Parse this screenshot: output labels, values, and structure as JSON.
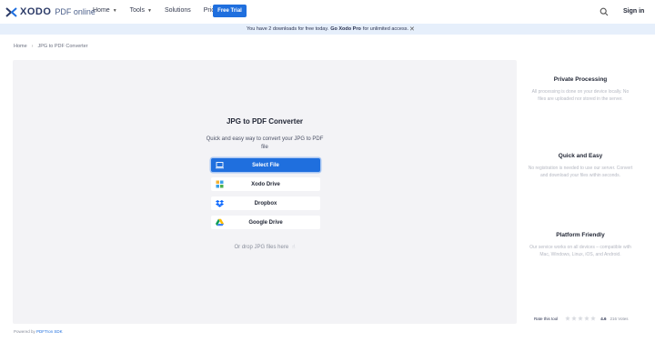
{
  "header": {
    "logo_text": "XODO",
    "logo_sub": "PDF online",
    "nav": [
      {
        "label": "Home",
        "dropdown": true
      },
      {
        "label": "Tools",
        "dropdown": true
      },
      {
        "label": "Solutions",
        "dropdown": false
      },
      {
        "label": "Pricing",
        "dropdown": false
      }
    ],
    "trial_label": "Free Trial",
    "signin_label": "Sign in"
  },
  "banner": {
    "text": "You have 2 downloads for free today.",
    "link": "Go Xodo Pro",
    "tail": "for unlimited access.",
    "close": "✕"
  },
  "breadcrumb": {
    "home": "Home",
    "separator": "›",
    "current": "JPG to PDF Converter"
  },
  "converter": {
    "title": "JPG to PDF Converter",
    "subtitle": "Quick and easy way to convert your JPG to PDF file",
    "options": [
      {
        "label": "Select File",
        "icon": "laptop-icon",
        "primary": true
      },
      {
        "label": "Xodo Drive",
        "icon": "xodo-drive-icon",
        "primary": false
      },
      {
        "label": "Dropbox",
        "icon": "dropbox-icon",
        "primary": false
      },
      {
        "label": "Google Drive",
        "icon": "google-drive-icon",
        "primary": false
      }
    ],
    "drop_text": "Or drop JPG files here"
  },
  "features": [
    {
      "title": "Private Processing",
      "text": "All processing is done on your device locally. No files are uploaded nor stored in the server."
    },
    {
      "title": "Quick and Easy",
      "text": "No registration is needed to use our server. Convert and download your files within seconds."
    },
    {
      "title": "Platform Friendly",
      "text": "Our service works on all devices – compatible with Mac, Windows, Linux, iOS, and Android."
    }
  ],
  "rating": {
    "label": "Rate this tool",
    "value": "4.6",
    "votes": "216 Votes",
    "stars_filled": 0,
    "stars_total": 5
  },
  "footer": {
    "powered": "Powered by",
    "sdk": "PDFTron SDK"
  },
  "colors": {
    "brand": "#1f6fde",
    "banner_bg": "#e6effb",
    "panel_bg": "#f3f3f6"
  }
}
